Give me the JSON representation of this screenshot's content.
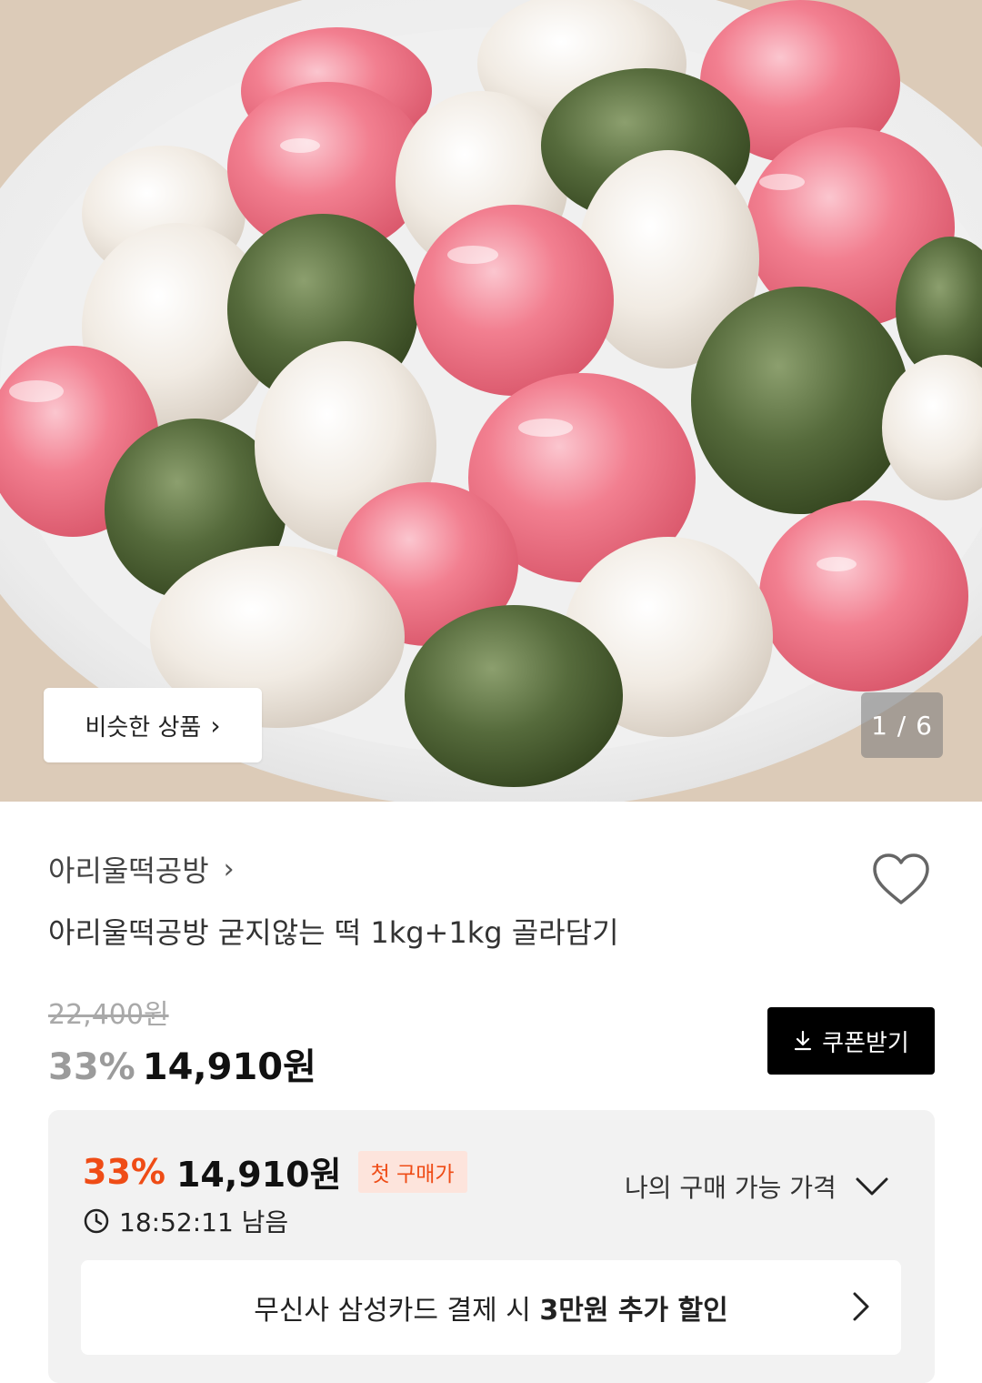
{
  "gallery": {
    "similar_label": "비슷한 상품",
    "similar_chevron": "chevron-right-icon",
    "counter": "1 / 6",
    "image_subject": "rice-cake-bowl"
  },
  "product": {
    "brand": "아리울떡공방",
    "name": "아리울떡공방 굳지않는 떡 1kg+1kg 골라담기",
    "original_price": "22,400원",
    "discount_rate": "33%",
    "price": "14,910원",
    "coupon_label": "쿠폰받기",
    "wishlist_icon": "heart-outline-icon"
  },
  "deal": {
    "rate": "33%",
    "price": "14,910원",
    "badge": "첫 구매가",
    "my_price_label": "나의 구매 가능 가격",
    "timer": "18:52:11 남음",
    "card_text_prefix": "무신사 삼성카드 결제 시 ",
    "card_text_bold": "3만원 추가 할인"
  },
  "colors": {
    "accent_orange": "#ef4c16",
    "badge_bg": "#fde4dc",
    "coupon_bg": "#000000",
    "deal_box_bg": "#f2f2f2"
  }
}
